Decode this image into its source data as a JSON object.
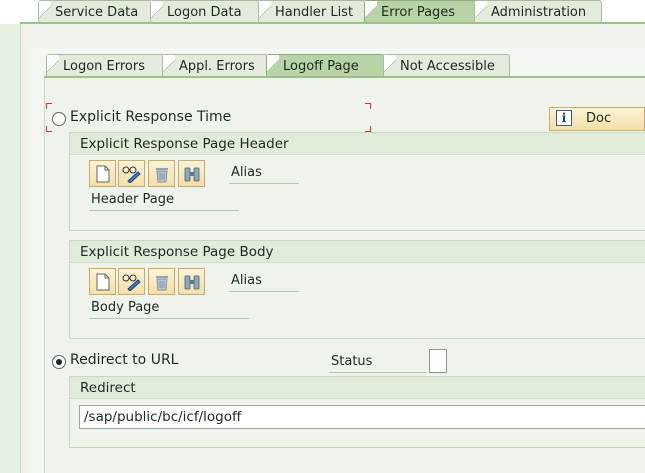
{
  "top_tabs": [
    {
      "label": "Service Data",
      "active": false
    },
    {
      "label": "Logon Data",
      "active": false
    },
    {
      "label": "Handler List",
      "active": false
    },
    {
      "label": "Error Pages",
      "active": true
    },
    {
      "label": "Administration",
      "active": false
    }
  ],
  "sub_tabs": [
    {
      "label": "Logon Errors",
      "active": false
    },
    {
      "label": "Appl. Errors",
      "active": false
    },
    {
      "label": "Logoff Page",
      "active": true
    },
    {
      "label": "Not Accessible",
      "active": false
    }
  ],
  "explicit": {
    "radio_label": "Explicit Response Time",
    "selected": false,
    "info_button": "Doc"
  },
  "header_group": {
    "title": "Explicit Response Page Header",
    "alias_label": "Alias",
    "page_label": "Header Page"
  },
  "body_group": {
    "title": "Explicit Response Page Body",
    "alias_label": "Alias",
    "page_label": "Body Page"
  },
  "redirect": {
    "radio_label": "Redirect to URL",
    "selected": true,
    "status_label": "Status",
    "group_title": "Redirect",
    "url": "/sap/public/bc/icf/logoff"
  },
  "colors": {
    "active_tab": "#b8d4a6",
    "button_fill": "#f3dfaa",
    "focus_marker": "#cc3b2a"
  }
}
